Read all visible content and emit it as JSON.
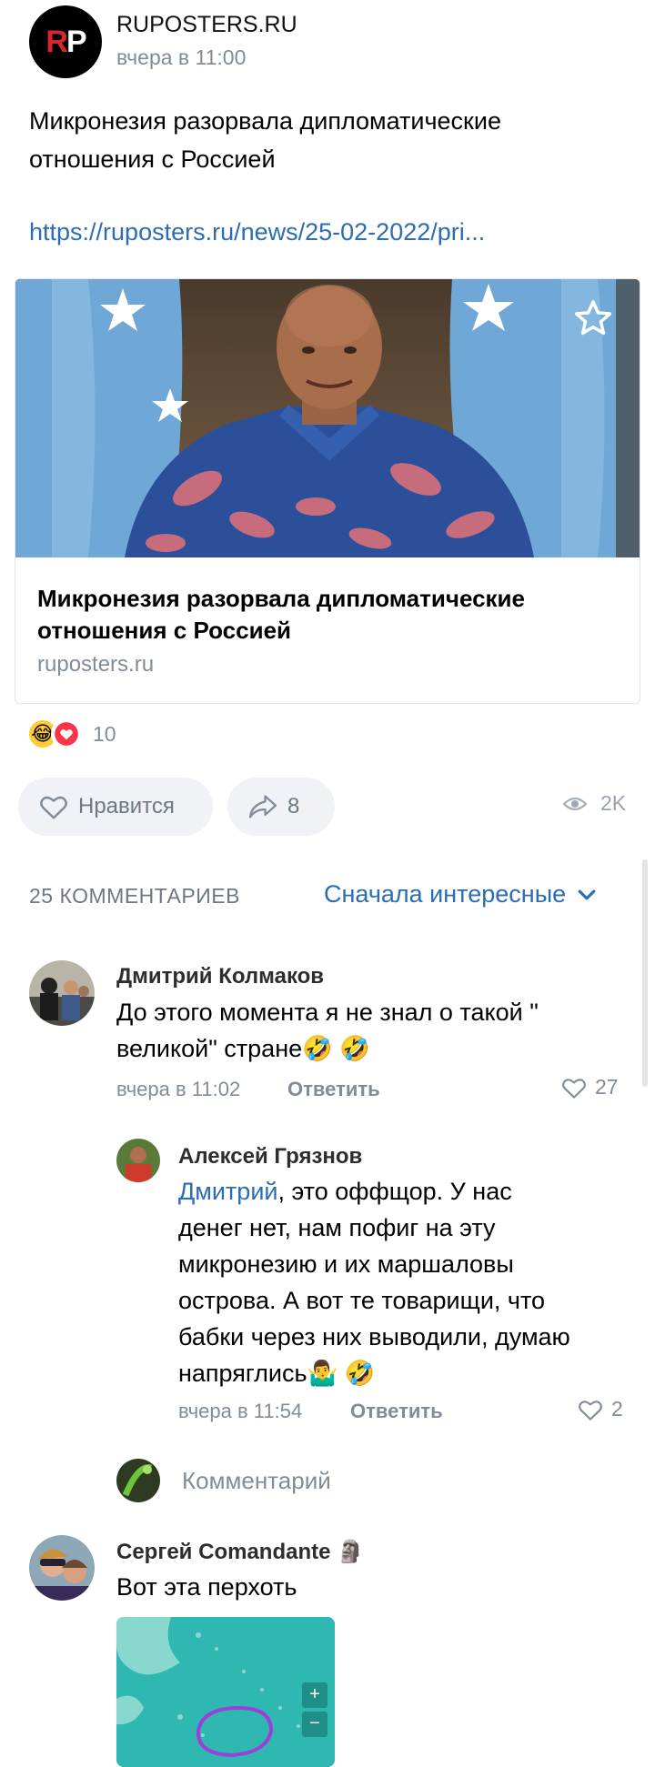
{
  "post": {
    "source_name": "RUPOSTERS.RU",
    "time": "вчера в 11:00",
    "logo_r": "R",
    "logo_p": "P",
    "text": "Микронезия разорвала дипломатические отношения с Россией",
    "link": "https://ruposters.ru/news/25-02-2022/pri..."
  },
  "card": {
    "title": "Микронезия разорвала дипломатические отношения с Россией",
    "domain": "ruposters.ru",
    "star_icon": "star-outline-icon"
  },
  "reactions": {
    "emojis": [
      "😂",
      "❤️"
    ],
    "count": "10"
  },
  "actions": {
    "like_label": "Нравится",
    "share_count": "8",
    "views": "2K"
  },
  "comments_header": {
    "count_label": "25 КОММЕНТАРИЕВ",
    "sort_label": "Сначала интересные"
  },
  "comments": [
    {
      "author": "Дмитрий Колмаков",
      "text_line1": "До этого момента я не знал о такой \"",
      "text_line2": "великой\" стране🤣 🤣",
      "time": "вчера в 11:02",
      "reply": "Ответить",
      "likes": "27"
    },
    {
      "author": "Алексей Грязнов",
      "mention": "Дмитрий",
      "text_line1": ", это оффщор.  У нас",
      "text_line2": "денег нет, нам пофиг на эту",
      "text_line3": "микронезию и их маршаловы",
      "text_line4": "острова. А вот те товарищи, что",
      "text_line5": "бабки через них выводили, думаю",
      "text_line6": "напряглись🤷‍♂️ 🤣",
      "time": "вчера в 11:54",
      "reply": "Ответить",
      "likes": "2"
    },
    {
      "author": "Сергей Comandante 🗿",
      "text_line1": "Вот эта перхоть"
    }
  ],
  "reply_input": {
    "placeholder": "Комментарий"
  },
  "map": {
    "zoom_in": "+",
    "zoom_out": "−"
  },
  "colors": {
    "accent": "#2a6db5",
    "muted": "#818c99",
    "button_bg": "#f0f2f5",
    "logo_red": "#d8262c"
  }
}
